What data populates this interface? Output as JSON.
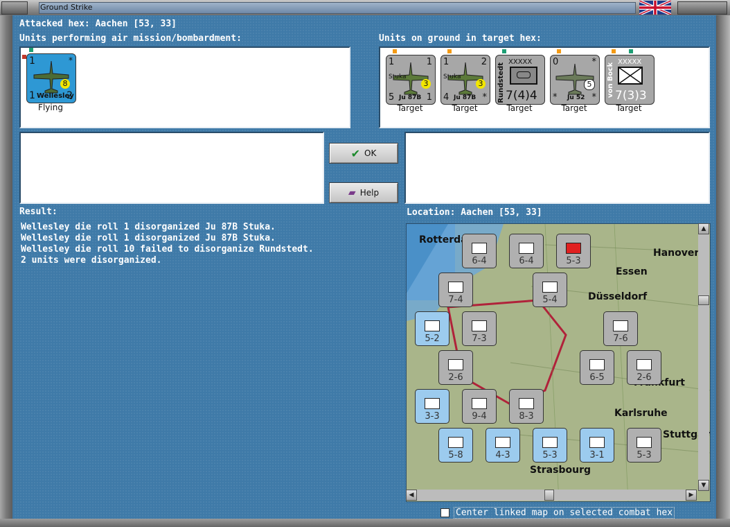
{
  "window": {
    "title": "Ground Strike"
  },
  "header": {
    "attacked_hex": "Attacked hex: Aachen  [53, 33]"
  },
  "air_panel": {
    "label": "Units performing air mission/bombardment:",
    "units": [
      {
        "name": "Wellesley",
        "tl": "1",
        "bl": "1",
        "br": "2",
        "badge": "8",
        "star": "*",
        "caption": "Flying"
      }
    ]
  },
  "ground_panel": {
    "label": "Units on ground in target hex:",
    "units": [
      {
        "name": "Ju 87B",
        "tag": "Stuka",
        "tl": "1",
        "tr": "1",
        "bl": "5",
        "br": "1",
        "badge": "3",
        "caption": "Target"
      },
      {
        "name": "Ju 87B",
        "tag": "Stuka",
        "tl": "1",
        "tr": "2",
        "bl": "4",
        "br": "*",
        "badge": "3",
        "caption": "Target"
      },
      {
        "name": "Rundstedt",
        "size": "XXXXX",
        "value": "7(4)4",
        "caption": "Target"
      },
      {
        "name": "Ju 52",
        "tl": "0",
        "tr": "*",
        "bl": "*",
        "br": "*",
        "badge": "5",
        "caption": "Target"
      },
      {
        "name": "von Bock",
        "size": "XXXXX",
        "value": "7(3)3",
        "caption": "Target"
      }
    ]
  },
  "buttons": {
    "ok": "OK",
    "help": "Help"
  },
  "result": {
    "label": "Result:",
    "lines": [
      "Wellesley die roll 1 disorganized Ju 87B Stuka.",
      "Wellesley die roll 1 disorganized Ju 87B Stuka.",
      "Wellesley die roll 10 failed to disorganize Rundstedt.",
      "2 units were disorganized."
    ]
  },
  "location": {
    "label": "Location:  Aachen  [53, 33]"
  },
  "map": {
    "cities": [
      "Rotterdam",
      "Hanover",
      "Essen",
      "Düsseldorf",
      "Frankfurt",
      "Karlsruhe",
      "Stuttgart",
      "Strasbourg"
    ],
    "counters": [
      {
        "v": "6-4",
        "t": "g"
      },
      {
        "v": "6-4",
        "t": "g"
      },
      {
        "v": "5-3",
        "t": "g"
      },
      {
        "v": "7-4",
        "t": "g"
      },
      {
        "v": "5-4",
        "t": "g"
      },
      {
        "v": "5-2",
        "t": "b"
      },
      {
        "v": "7-3",
        "t": "g"
      },
      {
        "v": "7-6",
        "t": "g"
      },
      {
        "v": "2-6",
        "t": "g"
      },
      {
        "v": "6-5",
        "t": "g"
      },
      {
        "v": "2-6",
        "t": "g"
      },
      {
        "v": "3-3",
        "t": "b"
      },
      {
        "v": "9-4",
        "t": "g"
      },
      {
        "v": "8-3",
        "t": "g"
      },
      {
        "v": "5-8",
        "t": "b"
      },
      {
        "v": "4-3",
        "t": "b"
      },
      {
        "v": "5-3",
        "t": "b"
      },
      {
        "v": "3-1",
        "t": "b"
      },
      {
        "v": "5-3",
        "t": "g"
      }
    ]
  },
  "options": {
    "center_map": "Center linked map on selected combat hex"
  },
  "colors": {
    "background": "#3f7aa8",
    "air_counter": "#2e98d4",
    "ground_counter": "#a7a7a7",
    "badge": "#f2e600"
  }
}
